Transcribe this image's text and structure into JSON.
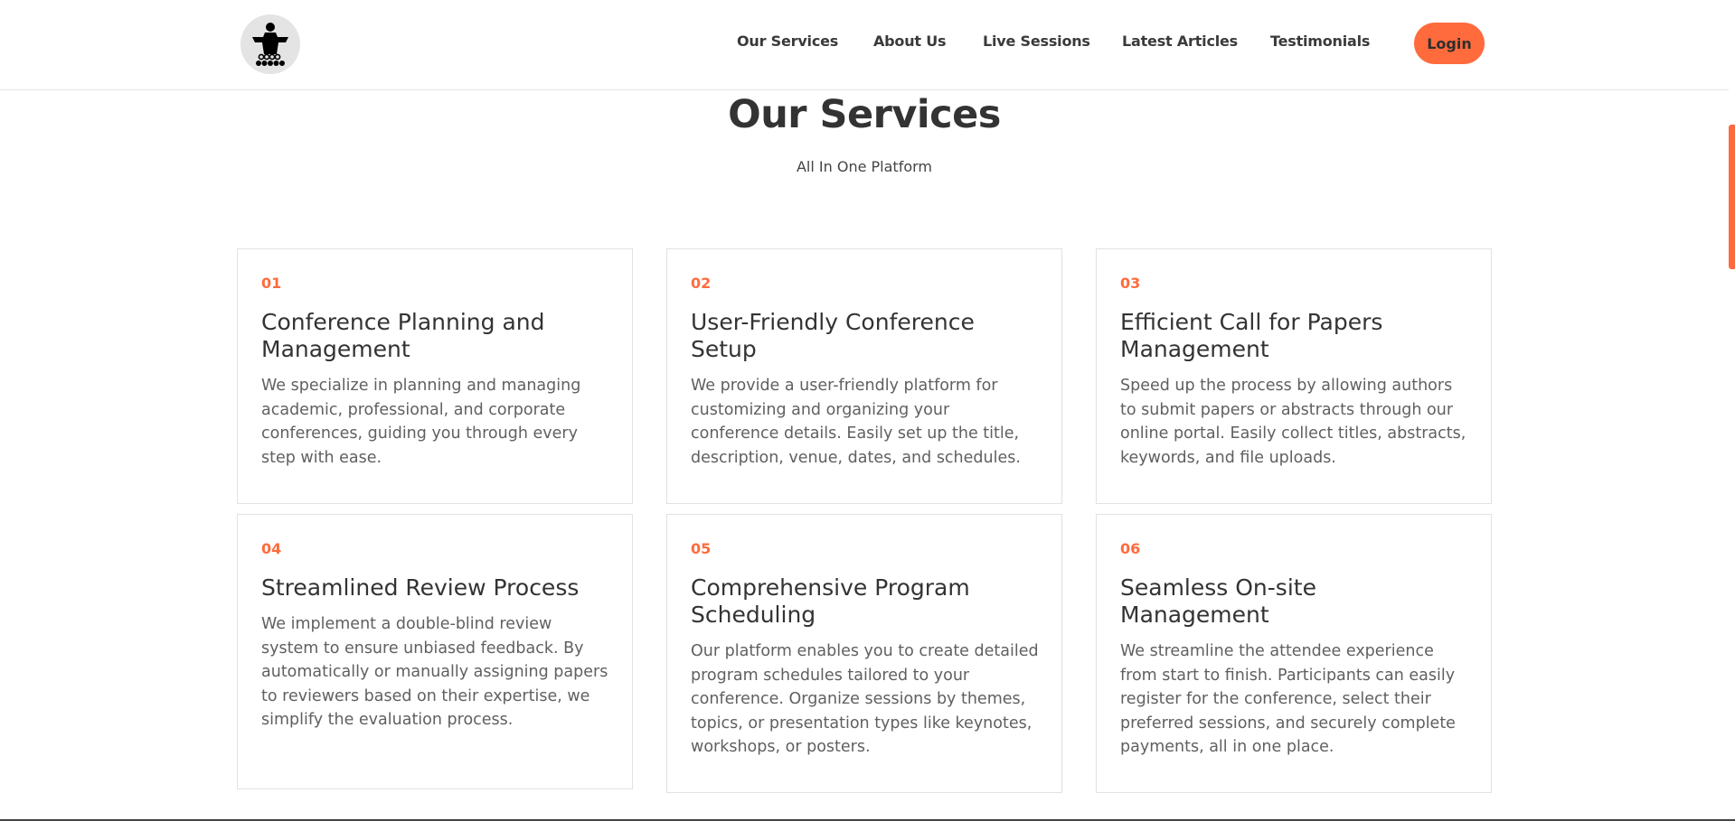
{
  "brand": {
    "logo_icon": "podium-speaker-icon"
  },
  "nav": {
    "items": [
      {
        "label": "Our Services"
      },
      {
        "label": "About Us"
      },
      {
        "label": "Live Sessions"
      },
      {
        "label": "Latest Articles"
      },
      {
        "label": "Testimonials"
      }
    ],
    "login_label": "Login"
  },
  "colors": {
    "accent": "#ff6b3d",
    "text": "#333333",
    "muted": "#606060"
  },
  "section": {
    "title": "Our Services",
    "subtitle": "All In One Platform"
  },
  "services": [
    {
      "number": "01",
      "title": "Conference Planning and Management",
      "description": "We specialize in planning and managing academic, professional, and corporate conferences, guiding you through every step with ease."
    },
    {
      "number": "02",
      "title": "User-Friendly Conference Setup",
      "description": "We provide a user-friendly platform for customizing and organizing your conference details. Easily set up the title, description, venue, dates, and schedules."
    },
    {
      "number": "03",
      "title": "Efficient Call for Papers Management",
      "description": "Speed up the process by allowing authors to submit papers or abstracts through our online portal. Easily collect titles, abstracts, keywords, and file uploads."
    },
    {
      "number": "04",
      "title": "Streamlined Review Process",
      "description": "We implement a double-blind review system to ensure unbiased feedback. By automatically or manually assigning papers to reviewers based on their expertise, we simplify the evaluation process."
    },
    {
      "number": "05",
      "title": "Comprehensive Program Scheduling",
      "description": "Our platform enables you to create detailed program schedules tailored to your conference. Organize sessions by themes, topics, or presentation types like keynotes, workshops, or posters."
    },
    {
      "number": "06",
      "title": "Seamless On-site Management",
      "description": "We streamline the attendee experience from start to finish. Participants can easily register for the conference, select their preferred sessions, and securely complete payments, all in one place."
    }
  ]
}
